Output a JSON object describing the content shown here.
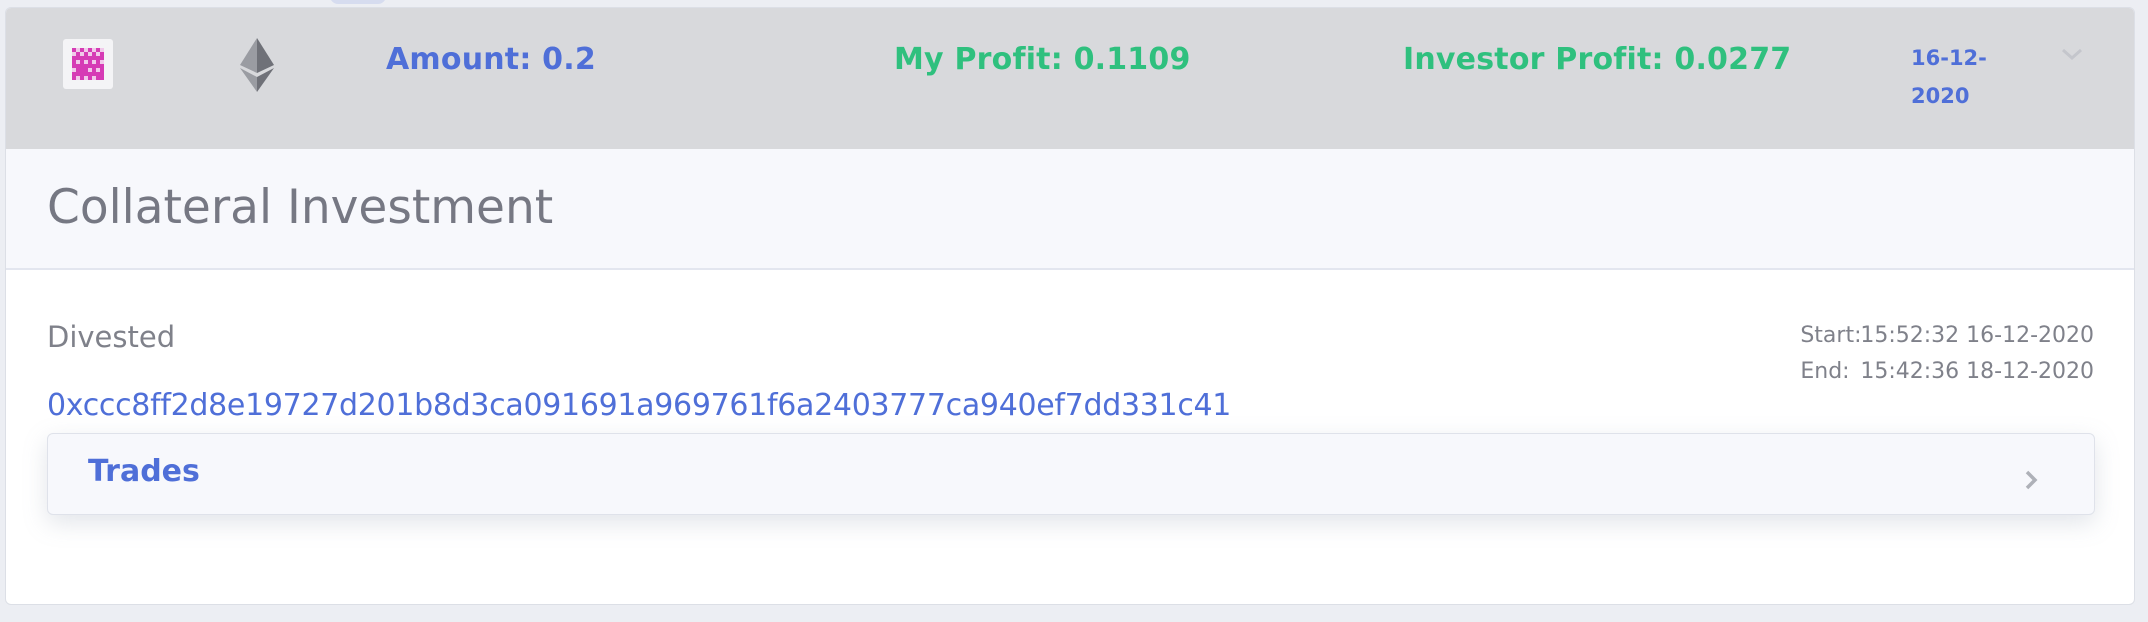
{
  "summary": {
    "token_icon": "checkered-token-icon",
    "chain_icon": "ethereum-icon",
    "amount": "Amount: 0.2",
    "my_profit": "My Profit: 0.1109",
    "investor_profit": "Investor Profit: 0.0277",
    "date_line1": "16-12-",
    "date_line2": "2020",
    "expand_icon": "chevron-down-icon"
  },
  "detail": {
    "title": "Collateral Investment",
    "status": "Divested",
    "tx_hash": "0xccc8ff2d8e19727d201b8d3ca091691a969761f6a2403777ca940ef7dd331c41",
    "start_label": "Start:",
    "start_value": "15:52:32 16-12-2020",
    "end_label": "End:",
    "end_value": "15:42:36 18-12-2020"
  },
  "trades": {
    "label": "Trades",
    "icon": "chevron-right-icon"
  },
  "colors": {
    "accent_blue": "#4f6fd8",
    "profit_green": "#2fc07e",
    "summary_bg": "#d8d9dc",
    "token_magenta": "#d63bb5"
  }
}
